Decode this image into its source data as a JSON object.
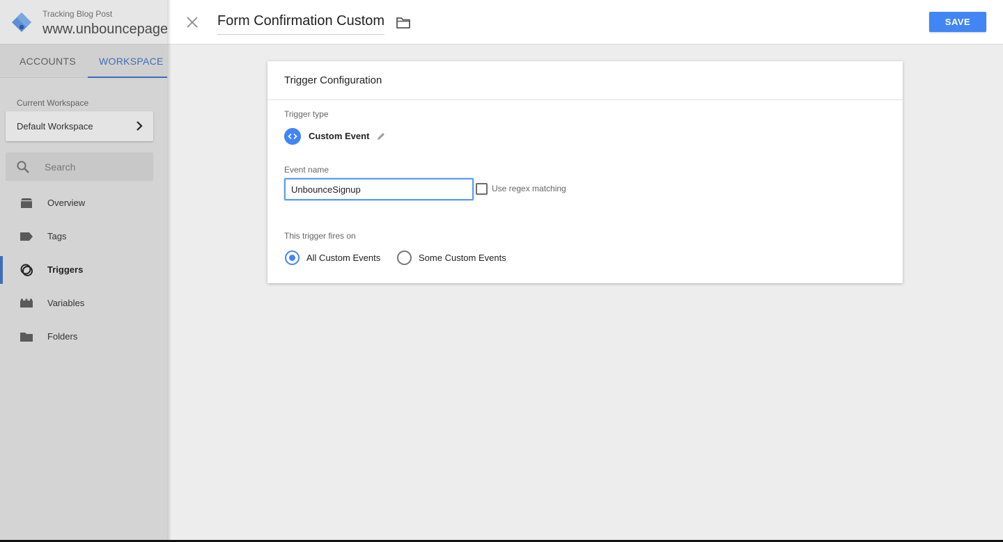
{
  "sidebar": {
    "container_subtitle": "Tracking Blog Post",
    "container_title": "www.unbouncepage",
    "tabs": [
      {
        "label": "ACCOUNTS",
        "active": false
      },
      {
        "label": "WORKSPACE",
        "active": true
      }
    ],
    "current_workspace_label": "Current Workspace",
    "current_workspace_value": "Default Workspace",
    "search_placeholder": "Search",
    "nav_items": [
      {
        "label": "Overview",
        "icon": "overview-icon",
        "active": false
      },
      {
        "label": "Tags",
        "icon": "tag-icon",
        "active": false
      },
      {
        "label": "Triggers",
        "icon": "trigger-icon",
        "active": true
      },
      {
        "label": "Variables",
        "icon": "variables-icon",
        "active": false
      },
      {
        "label": "Folders",
        "icon": "folder-icon",
        "active": false
      }
    ]
  },
  "editor": {
    "trigger_name": "Form Confirmation Custom",
    "save_label": "SAVE",
    "card": {
      "title": "Trigger Configuration",
      "trigger_type_label": "Trigger type",
      "trigger_type_value": "Custom Event",
      "event_name_label": "Event name",
      "event_name_value": "UnbounceSignup",
      "regex_label": "Use regex matching",
      "regex_checked": false,
      "fires_on_label": "This trigger fires on",
      "fires_on_options": [
        {
          "label": "All Custom Events",
          "selected": true
        },
        {
          "label": "Some Custom Events",
          "selected": false
        }
      ]
    }
  },
  "colors": {
    "accent_blue": "#4285f4",
    "sidebar_active": "#3f6db4"
  }
}
